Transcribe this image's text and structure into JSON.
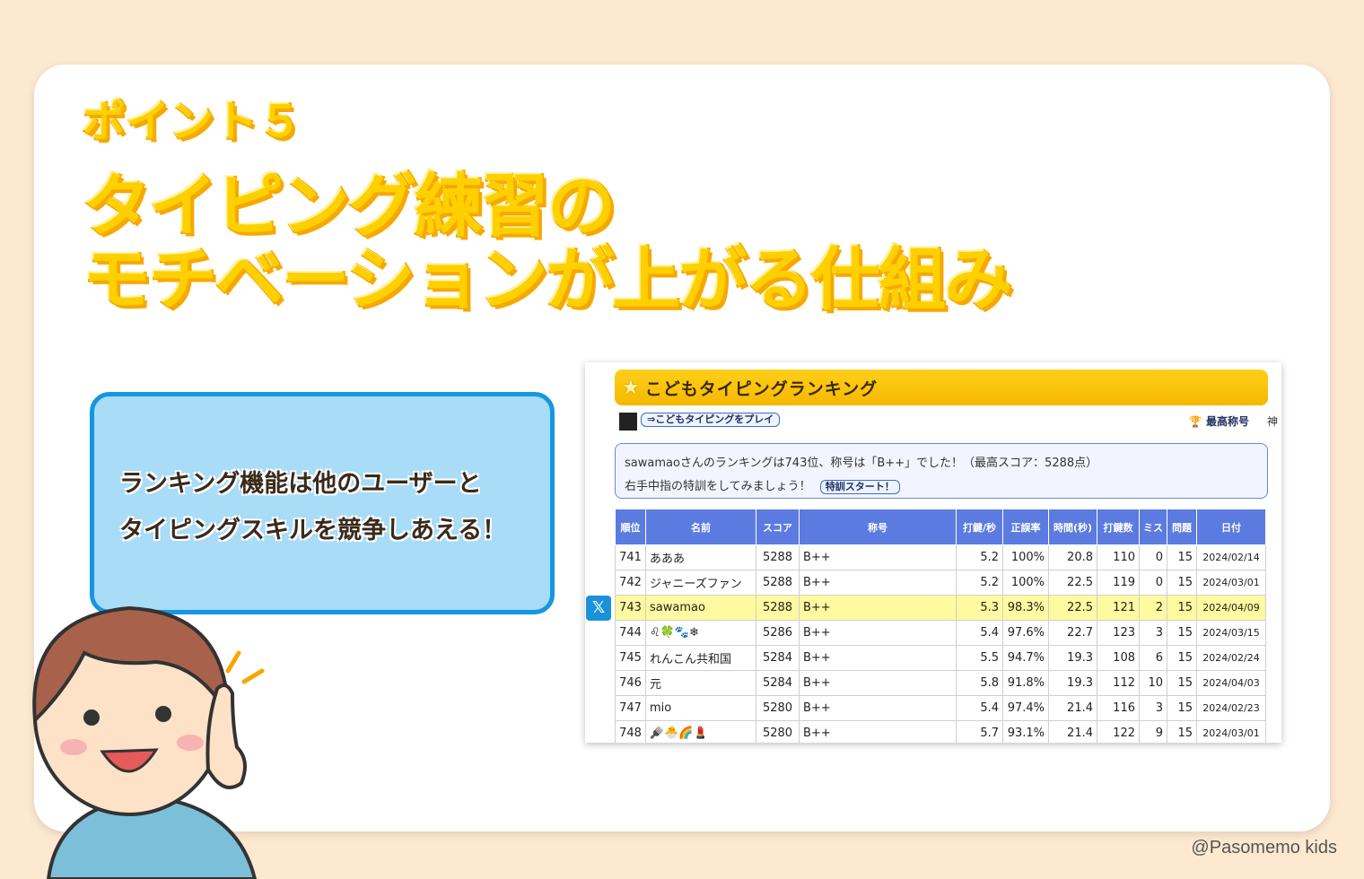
{
  "headline": {
    "kicker": "ポイント５",
    "title_line1": "タイピング練習の",
    "title_line2": "モチベーションが上がる仕組み"
  },
  "bubble": {
    "line1": "ランキング機能は他のユーザーと",
    "line2": "タイピングスキルを競争しあえる！"
  },
  "screenshot": {
    "header_title": "こどもタイピングランキング",
    "play_button": "⇒こどもタイピングをプレイ",
    "best_title_label": "最高称号",
    "best_title_value": "神",
    "rank_message": "sawamaoさんのランキングは743位、称号は「B++」でした！（最高スコア：5288点）",
    "training_message": "右手中指の特訓をしてみましょう！",
    "training_button": "特訓スタート！",
    "share_icon_glyph": "𝕏",
    "table": {
      "headers": [
        "順位",
        "名前",
        "スコア",
        "称号",
        "打鍵/秒",
        "正誤率",
        "時間(秒)",
        "打鍵数",
        "ミス",
        "問題",
        "日付"
      ],
      "rows": [
        {
          "rank": "741",
          "name": "あああ",
          "score": "5288",
          "title": "B++",
          "kps": "5.2",
          "accuracy": "100%",
          "time": "20.8",
          "keys": "110",
          "miss": "0",
          "questions": "15",
          "date": "2024/02/14"
        },
        {
          "rank": "742",
          "name": "ジャニーズファン",
          "score": "5288",
          "title": "B++",
          "kps": "5.2",
          "accuracy": "100%",
          "time": "22.5",
          "keys": "119",
          "miss": "0",
          "questions": "15",
          "date": "2024/03/01"
        },
        {
          "rank": "743",
          "name": "sawamao",
          "score": "5288",
          "title": "B++",
          "kps": "5.3",
          "accuracy": "98.3%",
          "time": "22.5",
          "keys": "121",
          "miss": "2",
          "questions": "15",
          "date": "2024/04/09"
        },
        {
          "rank": "744",
          "name": "♌🍀🐾❄",
          "score": "5286",
          "title": "B++",
          "kps": "5.4",
          "accuracy": "97.6%",
          "time": "22.7",
          "keys": "123",
          "miss": "3",
          "questions": "15",
          "date": "2024/03/15"
        },
        {
          "rank": "745",
          "name": "れんこん共和国",
          "score": "5284",
          "title": "B++",
          "kps": "5.5",
          "accuracy": "94.7%",
          "time": "19.3",
          "keys": "108",
          "miss": "6",
          "questions": "15",
          "date": "2024/02/24"
        },
        {
          "rank": "746",
          "name": "元",
          "score": "5284",
          "title": "B++",
          "kps": "5.8",
          "accuracy": "91.8%",
          "time": "19.3",
          "keys": "112",
          "miss": "10",
          "questions": "15",
          "date": "2024/04/03"
        },
        {
          "rank": "747",
          "name": "mio",
          "score": "5280",
          "title": "B++",
          "kps": "5.4",
          "accuracy": "97.4%",
          "time": "21.4",
          "keys": "116",
          "miss": "3",
          "questions": "15",
          "date": "2024/02/23"
        },
        {
          "rank": "748",
          "name": "🪮🐣🌈💄",
          "score": "5280",
          "title": "B++",
          "kps": "5.7",
          "accuracy": "93.1%",
          "time": "21.4",
          "keys": "122",
          "miss": "9",
          "questions": "15",
          "date": "2024/03/01"
        }
      ]
    }
  },
  "credit": "@Pasomemo kids",
  "colors": {
    "background": "#fde9d0",
    "headline_fill": "#ffd000",
    "bubble_fill": "#a8dcf7",
    "bubble_border": "#1596e0",
    "table_header": "#5b7be0",
    "highlight_row": "#fff9a0"
  }
}
